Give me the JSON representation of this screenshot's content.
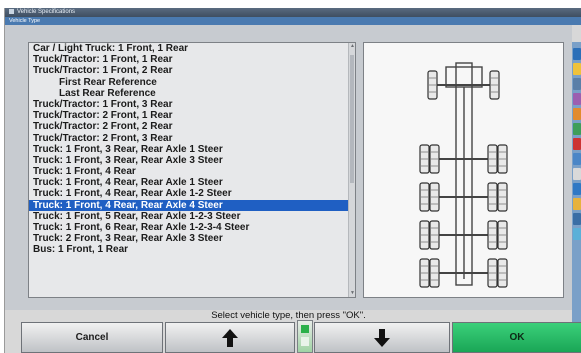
{
  "window": {
    "title": "Vehicle Specifications",
    "menu": "Vehicle Type"
  },
  "list": {
    "items": [
      {
        "label": "Car / Light Truck:  1 Front, 1 Rear",
        "indent": false,
        "selected": false
      },
      {
        "label": "Truck/Tractor:  1 Front, 1 Rear",
        "indent": false,
        "selected": false
      },
      {
        "label": "Truck/Tractor:  1 Front, 2 Rear",
        "indent": false,
        "selected": false
      },
      {
        "label": "First Rear Reference",
        "indent": true,
        "selected": false
      },
      {
        "label": "Last Rear Reference",
        "indent": true,
        "selected": false
      },
      {
        "label": "Truck/Tractor:  1 Front, 3 Rear",
        "indent": false,
        "selected": false
      },
      {
        "label": "Truck/Tractor:  2 Front, 1 Rear",
        "indent": false,
        "selected": false
      },
      {
        "label": "Truck/Tractor:  2 Front, 2 Rear",
        "indent": false,
        "selected": false
      },
      {
        "label": "Truck/Tractor:  2 Front, 3 Rear",
        "indent": false,
        "selected": false
      },
      {
        "label": "Truck:  1 Front, 3 Rear, Rear Axle 1 Steer",
        "indent": false,
        "selected": false
      },
      {
        "label": "Truck:  1 Front, 3 Rear, Rear Axle 3 Steer",
        "indent": false,
        "selected": false
      },
      {
        "label": "Truck:  1 Front, 4 Rear",
        "indent": false,
        "selected": false
      },
      {
        "label": "Truck:  1 Front, 4 Rear, Rear Axle 1 Steer",
        "indent": false,
        "selected": false
      },
      {
        "label": "Truck:  1 Front, 4 Rear, Rear Axle 1-2 Steer",
        "indent": false,
        "selected": false
      },
      {
        "label": "Truck:  1 Front, 4 Rear, Rear Axle 4 Steer",
        "indent": false,
        "selected": true
      },
      {
        "label": "Truck:  1 Front, 5 Rear, Rear Axle 1-2-3 Steer",
        "indent": false,
        "selected": false
      },
      {
        "label": "Truck:  1 Front, 6 Rear, Rear Axle 1-2-3-4 Steer",
        "indent": false,
        "selected": false
      },
      {
        "label": "Truck:  2 Front, 3 Rear, Rear Axle 3 Steer",
        "indent": false,
        "selected": false
      },
      {
        "label": "Bus:  1 Front, 1 Rear",
        "indent": false,
        "selected": false
      }
    ]
  },
  "prompt": "Select vehicle type, then press \"OK\".",
  "buttons": {
    "cancel": "Cancel",
    "up_icon": "arrow-up-icon",
    "down_icon": "arrow-down-icon",
    "ok": "OK"
  },
  "colors": {
    "selection": "#1f5fc3",
    "ok_button": "#1aa656",
    "side_toolbar": "#7aa0c8"
  }
}
